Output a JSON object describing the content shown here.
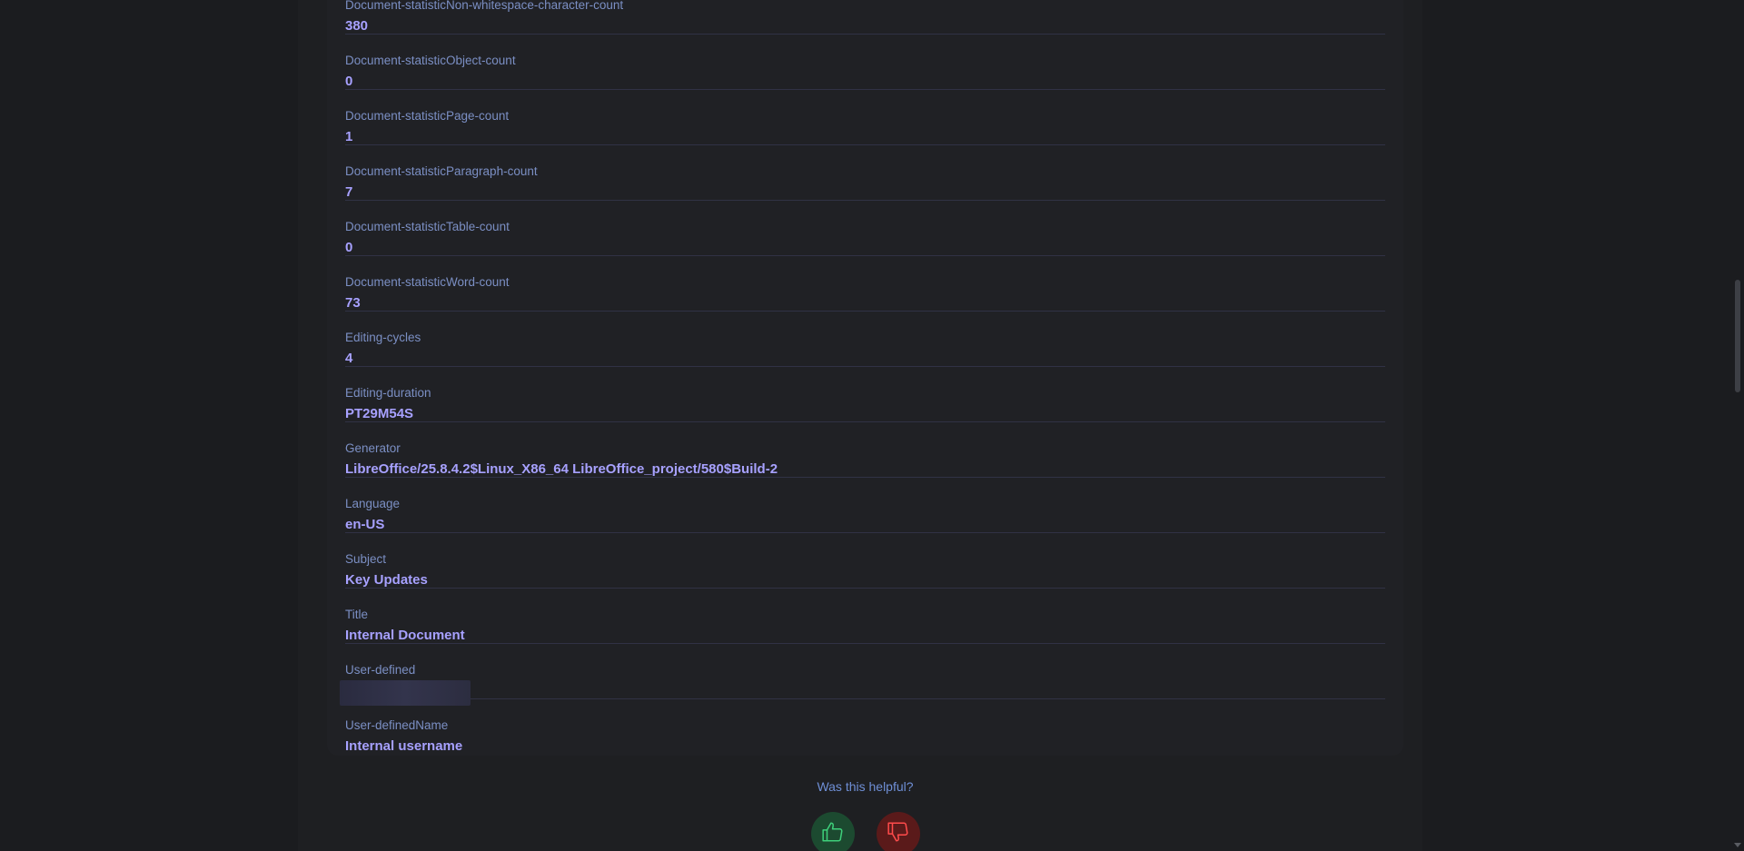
{
  "properties": [
    {
      "label": "Document-statisticNon-whitespace-character-count",
      "value": "380"
    },
    {
      "label": "Document-statisticObject-count",
      "value": "0"
    },
    {
      "label": "Document-statisticPage-count",
      "value": "1"
    },
    {
      "label": "Document-statisticParagraph-count",
      "value": "7"
    },
    {
      "label": "Document-statisticTable-count",
      "value": "0"
    },
    {
      "label": "Document-statisticWord-count",
      "value": "73"
    },
    {
      "label": "Editing-cycles",
      "value": "4"
    },
    {
      "label": "Editing-duration",
      "value": "PT29M54S"
    },
    {
      "label": "Generator",
      "value": "LibreOffice/25.8.4.2$Linux_X86_64 LibreOffice_project/580$Build-2"
    },
    {
      "label": "Language",
      "value": "en-US"
    },
    {
      "label": "Subject",
      "value": "Key Updates"
    },
    {
      "label": "Title",
      "value": "Internal Document"
    },
    {
      "label": "User-defined",
      "value": ""
    },
    {
      "label": "User-definedName",
      "value": "Internal username"
    }
  ],
  "feedback": {
    "question": "Was this helpful?",
    "yes_icon": "thumbs-up-icon",
    "no_icon": "thumbs-down-icon",
    "yes_color": "#1c4a30",
    "no_color": "#5a1a1a"
  },
  "colors": {
    "label": "#7b8fc4",
    "value": "#a7a1ff",
    "background": "#1e1f22"
  }
}
